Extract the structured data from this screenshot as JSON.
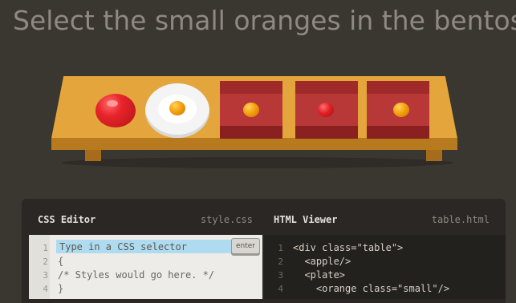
{
  "instructions": {
    "title": "Select the small oranges in the bentos"
  },
  "table": {
    "items": [
      {
        "type": "apple",
        "container": "none"
      },
      {
        "type": "orange",
        "container": "plate"
      },
      {
        "type": "small-orange",
        "container": "bento"
      },
      {
        "type": "small-apple",
        "container": "bento"
      },
      {
        "type": "small-orange",
        "container": "bento"
      }
    ]
  },
  "css_editor": {
    "title": "CSS Editor",
    "file": "style.css",
    "input_placeholder": "Type in a CSS selector",
    "enter_label": "enter",
    "lines": [
      {
        "n": "1",
        "text": ""
      },
      {
        "n": "2",
        "text": "{"
      },
      {
        "n": "3",
        "text": "/* Styles would go here. */"
      },
      {
        "n": "4",
        "text": "}"
      }
    ]
  },
  "html_viewer": {
    "title": "HTML Viewer",
    "file": "table.html",
    "lines": [
      {
        "n": "1",
        "text": "<div class=\"table\">"
      },
      {
        "n": "2",
        "text": "  <apple/>"
      },
      {
        "n": "3",
        "text": "  <plate>"
      },
      {
        "n": "4",
        "text": "    <orange class=\"small\"/>"
      }
    ]
  },
  "colors": {
    "background": "#3a3630",
    "table": "#e4a53c",
    "bento": "#b83838",
    "apple": "#e8242b",
    "orange": "#f5a20d",
    "input_highlight": "#aedbf0"
  }
}
